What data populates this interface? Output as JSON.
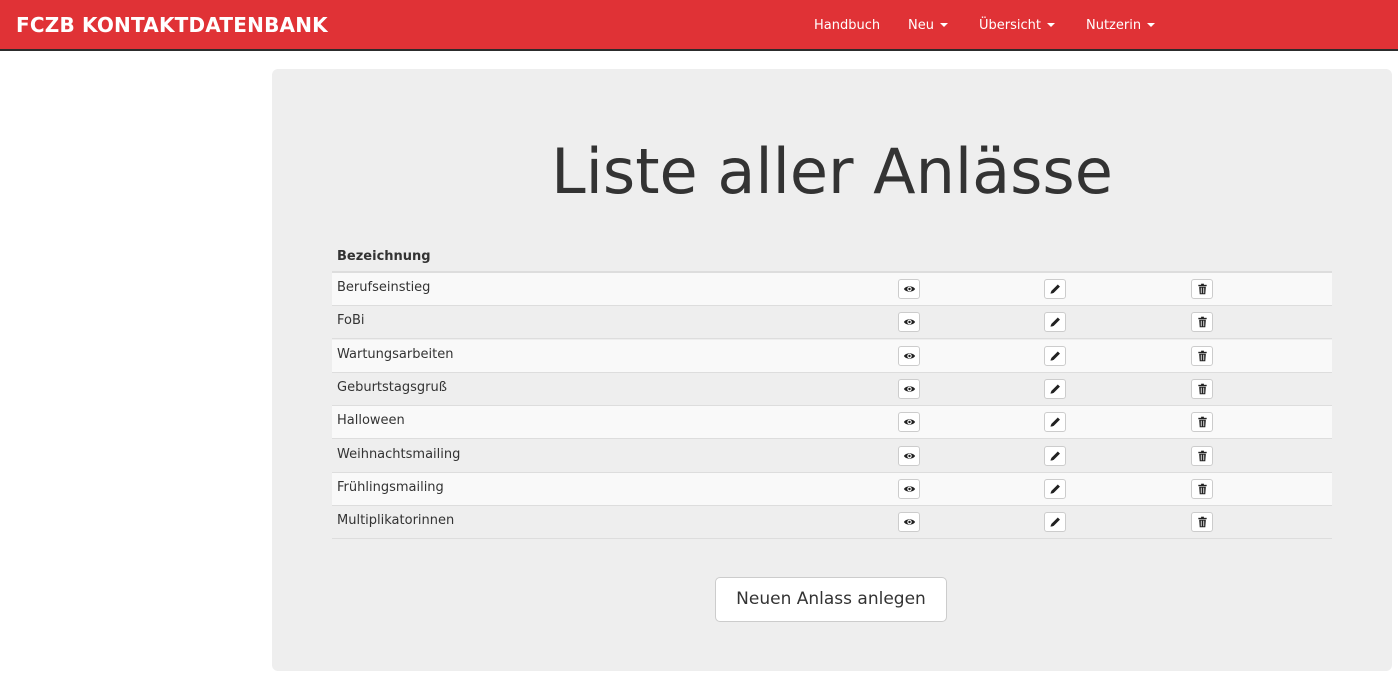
{
  "navbar": {
    "brand": "FCZB KONTAKTDATENBANK",
    "items": [
      {
        "label": "Handbuch",
        "dropdown": false
      },
      {
        "label": "Neu",
        "dropdown": true
      },
      {
        "label": "Übersicht",
        "dropdown": true
      },
      {
        "label": "Nutzerin",
        "dropdown": true
      }
    ],
    "color": "#e03236"
  },
  "main": {
    "title": "Liste aller Anlässe",
    "table": {
      "column_header": "Bezeichnung",
      "rows": [
        {
          "label": "Berufseinstieg"
        },
        {
          "label": "FoBi"
        },
        {
          "label": "Wartungsarbeiten"
        },
        {
          "label": "Geburtstagsgruß"
        },
        {
          "label": "Halloween"
        },
        {
          "label": "Weihnachtsmailing"
        },
        {
          "label": "Frühlingsmailing"
        },
        {
          "label": "Multiplikatorinnen"
        }
      ],
      "row_actions": [
        "eye-icon",
        "pencil-icon",
        "trash-icon"
      ]
    },
    "new_button_label": "Neuen Anlass anlegen"
  }
}
